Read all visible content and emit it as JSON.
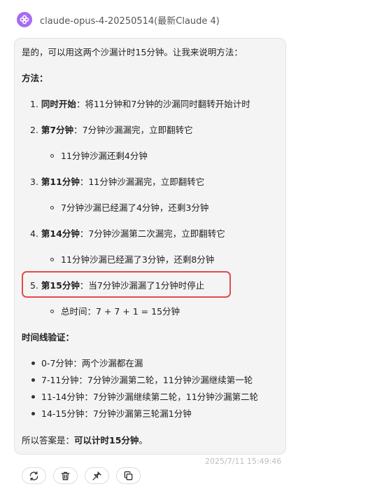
{
  "header": {
    "model_name": "claude-opus-4-20250514(最新Claude 4)"
  },
  "message": {
    "intro": "是的，可以用这两个沙漏计时15分钟。让我来说明方法：",
    "method_heading": "方法：",
    "steps": [
      {
        "num": "1.",
        "title": "同时开始",
        "desc": "：将11分钟和7分钟的沙漏同时翻转开始计时",
        "sub": ""
      },
      {
        "num": "2.",
        "title": "第7分钟",
        "desc": "：7分钟沙漏漏完，立即翻转它",
        "sub": "11分钟沙漏还剩4分钟"
      },
      {
        "num": "3.",
        "title": "第11分钟",
        "desc": "：11分钟沙漏漏完，立即翻转它",
        "sub": "7分钟沙漏已经漏了4分钟，还剩3分钟"
      },
      {
        "num": "4.",
        "title": "第14分钟",
        "desc": "：7分钟沙漏第二次漏完，立即翻转它",
        "sub": "11分钟沙漏已经漏了3分钟，还剩8分钟"
      },
      {
        "num": "5.",
        "title": "第15分钟",
        "desc": "：当7分钟沙漏漏了1分钟时停止",
        "sub": "总时间：7 + 7 + 1 = 15分钟"
      }
    ],
    "timeline_heading": "时间线验证：",
    "timeline": [
      "0-7分钟：两个沙漏都在漏",
      "7-11分钟：7分钟沙漏第二轮，11分钟沙漏继续第一轮",
      "11-14分钟：7分钟沙漏继续第二轮，11分钟沙漏第二轮",
      "14-15分钟：7分钟沙漏第三轮漏1分钟"
    ],
    "conclusion_prefix": "所以答案是：",
    "conclusion_bold": "可以计时15分钟",
    "conclusion_suffix": "。"
  },
  "timestamp": "2025/7/11 15:49:46",
  "colors": {
    "avatar": "#a66cf2",
    "highlight": "#e24b4b"
  },
  "actions": [
    {
      "name": "regenerate-button",
      "icon": "refresh-icon"
    },
    {
      "name": "delete-button",
      "icon": "trash-icon"
    },
    {
      "name": "pin-button",
      "icon": "pin-icon"
    },
    {
      "name": "copy-button",
      "icon": "copy-icon"
    }
  ]
}
